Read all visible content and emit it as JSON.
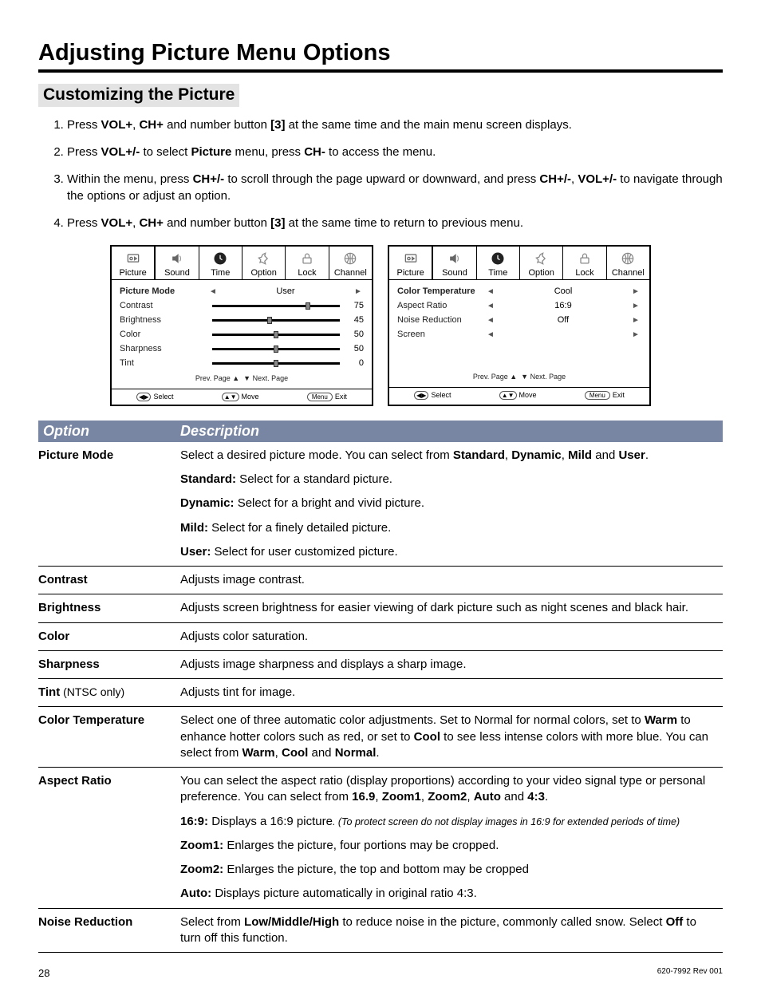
{
  "title": "Adjusting Picture Menu Options",
  "subtitle": "Customizing the Picture",
  "steps": [
    {
      "pre": "Press ",
      "b1": "VOL+",
      "mid1": ", ",
      "b2": "CH+",
      "mid2": " and number button ",
      "b3": "[3]",
      "post": " at the same time and the main menu screen displays."
    },
    {
      "pre": "Press ",
      "b1": "VOL+/-",
      "mid1": " to select ",
      "b2": "Picture",
      "mid2": " menu, press ",
      "b3": "CH-",
      "post": " to access the menu."
    },
    {
      "pre": "Within the menu, press ",
      "b1": "CH+/-",
      "mid1": " to scroll through the page upward or downward, and press ",
      "b2": "CH+/-",
      "mid2": ", ",
      "b3": "VOL+/-",
      "post": " to navigate through the options or adjust an option."
    },
    {
      "pre": "Press ",
      "b1": "VOL+",
      "mid1": ", ",
      "b2": "CH+",
      "mid2": " and number button ",
      "b3": "[3]",
      "post": " at the same time to return to previous menu."
    }
  ],
  "osd": {
    "tabs": [
      "Picture",
      "Sound",
      "Time",
      "Option",
      "Lock",
      "Channel"
    ],
    "panel1": {
      "mode_label": "Picture Mode",
      "mode_value": "User",
      "rows": [
        {
          "label": "Contrast",
          "value": 75,
          "pct": 75
        },
        {
          "label": "Brightness",
          "value": 45,
          "pct": 45
        },
        {
          "label": "Color",
          "value": 50,
          "pct": 50
        },
        {
          "label": "Sharpness",
          "value": 50,
          "pct": 50
        },
        {
          "label": "Tint",
          "value": 0,
          "pct": 50
        }
      ]
    },
    "panel2": {
      "rows": [
        {
          "label": "Color Temperature",
          "value": "Cool",
          "sel": true
        },
        {
          "label": "Aspect Ratio",
          "value": "16:9"
        },
        {
          "label": "Noise Reduction",
          "value": "Off"
        },
        {
          "label": "Screen",
          "value": ""
        }
      ]
    },
    "pager_prev": "Prev. Page",
    "pager_next": "Next. Page",
    "footer": {
      "select": "Select",
      "move": "Move",
      "menu": "Menu",
      "exit": "Exit"
    }
  },
  "table_header": {
    "c1": "Option",
    "c2": "Description"
  },
  "rows": {
    "picture_mode": {
      "name": "Picture Mode",
      "intro_a": "Select a desired picture mode. You can select from ",
      "opts": [
        "Standard",
        "Dynamic",
        "Mild",
        "User"
      ],
      "and": " and ",
      "period": ".",
      "lines": [
        {
          "k": "Standard:",
          "v": " Select for a standard picture."
        },
        {
          "k": "Dynamic:",
          "v": " Select for a bright and vivid picture."
        },
        {
          "k": "Mild:",
          "v": " Select for a finely detailed picture."
        },
        {
          "k": "User:",
          "v": " Select for user customized picture."
        }
      ]
    },
    "contrast": {
      "name": "Contrast",
      "desc": "Adjusts image contrast."
    },
    "brightness": {
      "name": "Brightness",
      "desc": "Adjusts screen brightness for easier viewing of dark picture such as night scenes and black hair."
    },
    "color": {
      "name": "Color",
      "desc": "Adjusts color saturation."
    },
    "sharpness": {
      "name": "Sharpness",
      "desc": "Adjusts image sharpness and displays a sharp image."
    },
    "tint": {
      "name": "Tint",
      "note": "  (NTSC only)",
      "desc": "Adjusts tint for image."
    },
    "color_temp": {
      "name": "Color Temperature",
      "p1a": "Select one of three automatic color adjustments. Set to Normal for normal colors, set to ",
      "warm": "Warm",
      "p1b": " to enhance hotter colors such as red, or set to ",
      "cool": "Cool",
      "p1c": " to see less intense colors with more blue.  You can select from ",
      "opts": [
        "Warm",
        "Cool",
        "Normal"
      ],
      "and": " and ",
      "period": "."
    },
    "aspect": {
      "name": "Aspect Ratio",
      "intro_a": "You can select the aspect ratio (display proportions) according to your video signal type or personal preference. You can select from ",
      "opts": [
        "16.9",
        "Zoom1",
        "Zoom2",
        "Auto",
        "4:3"
      ],
      "and": " and ",
      "period": ".",
      "l1k": "16:9:",
      "l1v": " Displays a 16:9 picture",
      "l1fine": ". (To protect screen do not display images in 16:9 for extended periods of time)",
      "l2k": "Zoom1:",
      "l2v": " Enlarges the picture, four portions may be cropped.",
      "l3k": "Zoom2:",
      "l3v": " Enlarges the picture, the top and bottom may be cropped",
      "l4k": "Auto:",
      "l4v": " Displays picture automatically in original ratio 4:3."
    },
    "noise": {
      "name": "Noise Reduction",
      "a": "Select from ",
      "opts": "Low/Middle/High",
      "b": " to reduce noise in the picture, commonly called snow. Select ",
      "off": "Off",
      "c": " to turn off this function."
    }
  },
  "footer": {
    "page": "28",
    "rev": "620-7992 Rev 001"
  }
}
